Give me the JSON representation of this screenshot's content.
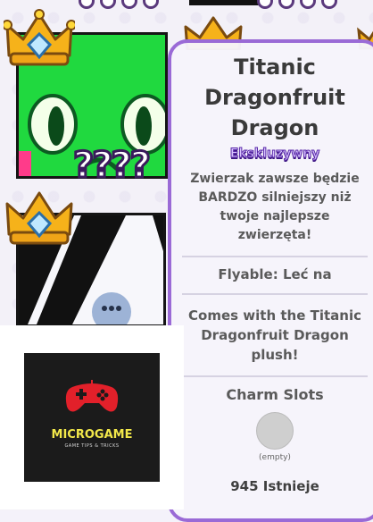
{
  "card": {
    "title": "Titanic Dragonfruit Dragon",
    "rarity": "Ekskluzywny",
    "description": "Zwierzak zawsze będzie BARDZO silniejszy niż twoje najlepsze zwierzęta!",
    "flyable": "Flyable: Leć na",
    "plush_note": "Comes with the Titanic Dragonfruit Dragon plush!",
    "charm_slots_title": "Charm Slots",
    "charm_slot_state": "(empty)",
    "exists_count": "945 Istnieje"
  },
  "tiles": {
    "mystery_marks": "????"
  },
  "ad": {
    "brand": "MICROGAME",
    "tagline": "GAME TIPS & TRICKS"
  },
  "colors": {
    "panel_border": "#9a6ad6",
    "rarity_text": "#5a2aa8",
    "tile_green": "#20d93f",
    "ad_brand": "#f2e84a"
  },
  "icons": [
    "crown-icon",
    "gamepad-icon"
  ]
}
